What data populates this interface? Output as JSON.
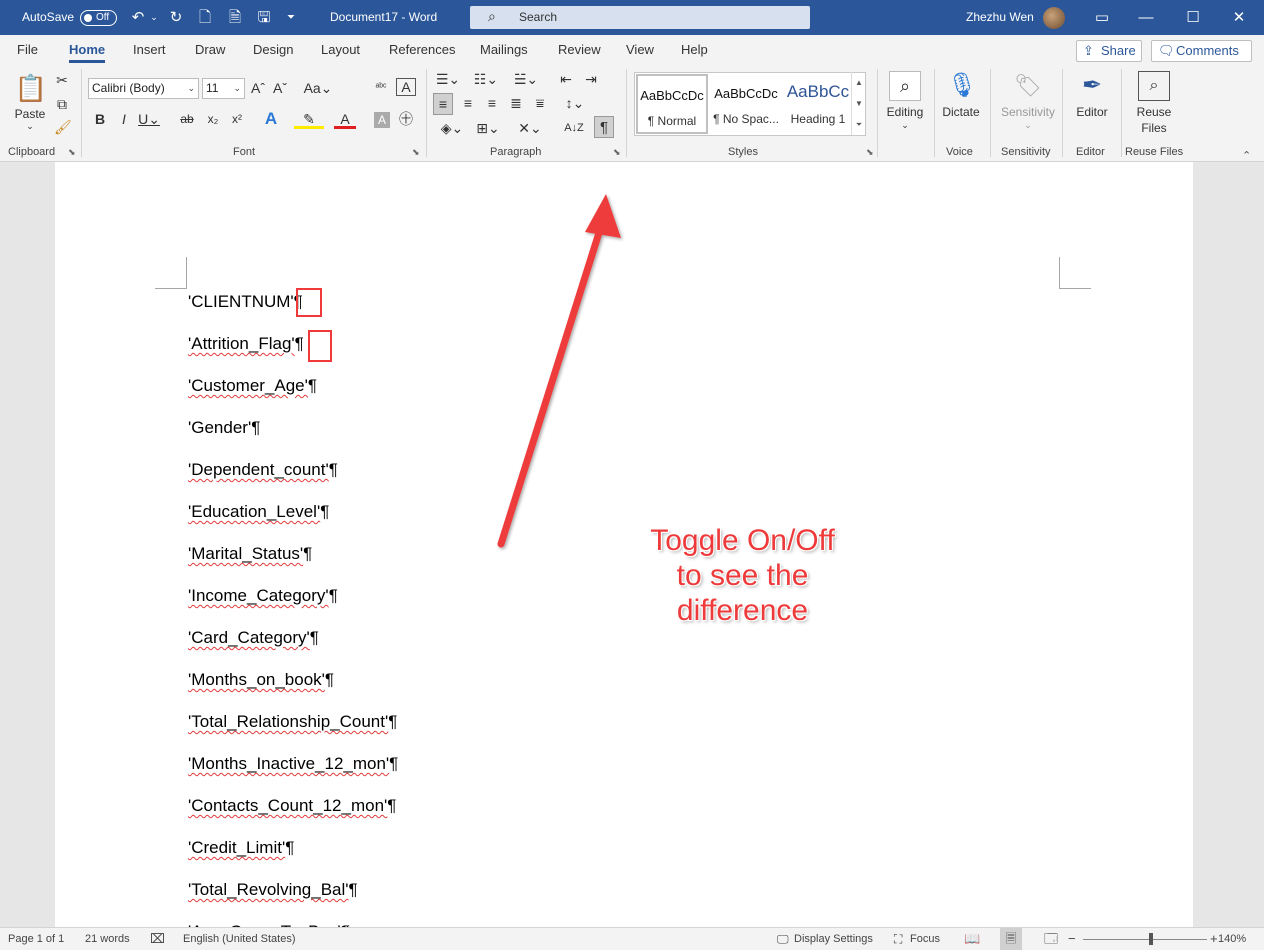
{
  "titlebar": {
    "autosave_label": "AutoSave",
    "autosave_state": "Off",
    "doc_title": "Document17  -  Word",
    "search_placeholder": "Search",
    "user_name": "Zhezhu Wen",
    "color": "#2b579a"
  },
  "tabs": [
    "File",
    "Home",
    "Insert",
    "Draw",
    "Design",
    "Layout",
    "References",
    "Mailings",
    "Review",
    "View",
    "Help"
  ],
  "active_tab": "Home",
  "header_buttons": {
    "share": "Share",
    "comments": "Comments"
  },
  "ribbon": {
    "clipboard": {
      "paste": "Paste",
      "group": "Clipboard"
    },
    "font": {
      "name": "Calibri (Body)",
      "size": "11",
      "group": "Font"
    },
    "paragraph": {
      "group": "Paragraph"
    },
    "styles": {
      "group": "Styles",
      "items": [
        {
          "sample": "AaBbCcDc",
          "name": "¶ Normal"
        },
        {
          "sample": "AaBbCcDc",
          "name": "¶ No Spac..."
        },
        {
          "sample": "AaBbCc",
          "name": "Heading 1"
        }
      ]
    },
    "editing": {
      "label": "Editing"
    },
    "voice": {
      "label": "Dictate",
      "group": "Voice"
    },
    "sensitivity": {
      "label": "Sensitivity",
      "group": "Sensitivity"
    },
    "editor": {
      "label": "Editor",
      "group": "Editor"
    },
    "reuse": {
      "label1": "Reuse",
      "label2": "Files",
      "group": "Reuse Files"
    }
  },
  "document": {
    "lines": [
      "'CLIENTNUM'",
      "'Attrition_Flag'",
      "'Customer_Age'",
      "'Gender'",
      "'Dependent_count'",
      "'Education_Level'",
      "'Marital_Status'",
      "'Income_Category'",
      "'Card_Category'",
      "'Months_on_book'",
      "'Total_Relationship_Count'",
      "'Months_Inactive_12_mon'",
      "'Contacts_Count_12_mon'",
      "'Credit_Limit'",
      "'Total_Revolving_Bal'",
      "'Avg_Open_To_Buy'"
    ],
    "pilcrow": "¶"
  },
  "annotation": {
    "line1": "Toggle On/Off",
    "line2": "to see the",
    "line3": "difference",
    "color": "#ee3a3a"
  },
  "statusbar": {
    "page": "Page 1 of 1",
    "words": "21 words",
    "language": "English (United States)",
    "display_settings": "Display Settings",
    "focus": "Focus",
    "zoom": "140%",
    "zoom_level": 140
  }
}
